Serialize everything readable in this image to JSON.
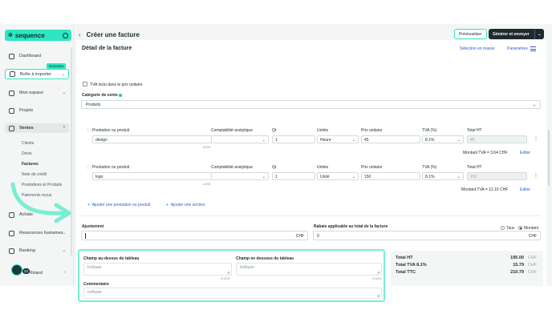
{
  "colors": {
    "accent": "#2ee6c4",
    "link": "#2a5fd0",
    "dark": "#1f2a2e",
    "annotation": "#7aeed4"
  },
  "sidebar": {
    "logo": "sequence",
    "badge_new": "Nouveau",
    "items": [
      {
        "label": "Dashboard",
        "icon": "home-icon"
      },
      {
        "label": "Boîte à importer",
        "icon": "inbox-icon"
      },
      {
        "label": "Mon espace",
        "icon": "user-icon"
      },
      {
        "label": "Projets",
        "icon": "checkbox-icon"
      },
      {
        "label": "Ventes",
        "icon": "tag-icon"
      },
      {
        "label": "Achats",
        "icon": "bag-icon"
      },
      {
        "label": "Ressources humaines",
        "icon": "people-icon"
      },
      {
        "label": "Banking",
        "icon": "bank-icon"
      }
    ],
    "ventes_sub": [
      "Clients",
      "Devis",
      "Factures",
      "Note de crédit",
      "Prestations et Produits",
      "Paiements reçus"
    ],
    "user": {
      "name": "Roland",
      "badge": "22"
    }
  },
  "header": {
    "title": "Créer une facture",
    "preview_label": "Prévisualiser",
    "generate_label": "Générer et envoyer"
  },
  "detail": {
    "title": "Détail de la facture",
    "link_bulk": "Sélection en masse",
    "link_params": "Paramètres",
    "checkbox_vat": "TVA inclu dans le prix unitaire",
    "category_label": "Catégorie de vente",
    "category_value": "Produits",
    "columns": {
      "product": "Prestation ou produit",
      "accounting": "Comptabilité analytique",
      "qty": "Qt",
      "unit": "Unités",
      "unit_price": "Prix unitaire",
      "vat": "TVA (%)",
      "total": "Total HT"
    },
    "lines": [
      {
        "product": "design",
        "counter": "6/255",
        "qty": "1",
        "unit": "Heure",
        "price": "45",
        "vat": "8.1%",
        "total": "45",
        "vat_amount": "Montant TVA = 3.64 CHF",
        "edit": "Editer"
      },
      {
        "product": "logo",
        "counter": "4/255",
        "qty": "1",
        "unit": "Unité",
        "price": "150",
        "vat": "8.1%",
        "total": "150",
        "vat_amount": "Montant TVA = 12.15 CHF",
        "edit": "Editer"
      }
    ],
    "add_item": "Ajouter une prestation ou produit",
    "add_section": "Ajouter une section",
    "adjustment_label": "Ajustement",
    "adjustment_unit": "CHF",
    "discount_label": "Rabais applicable au total de la facture",
    "discount_rate": "Taux",
    "discount_amount": "Montant",
    "discount_value": "0",
    "discount_unit": "CHF"
  },
  "notes": {
    "above_label": "Champ au-dessus du tableau",
    "above_placeholder": "Indiquer",
    "above_counter": "0/1000",
    "below_label": "Champ en dessous du tableau",
    "below_placeholder": "Indiquer",
    "below_counter": "0/1000",
    "comment_label": "Commentaire",
    "comment_placeholder": "Indiquer"
  },
  "totals": {
    "ht_label": "Total HT",
    "ht_value": "195.00",
    "tva_label": "Total TVA 8.1%",
    "tva_value": "15.79",
    "ttc_label": "Total TTC",
    "ttc_value": "210.79",
    "currency": "CHF"
  }
}
